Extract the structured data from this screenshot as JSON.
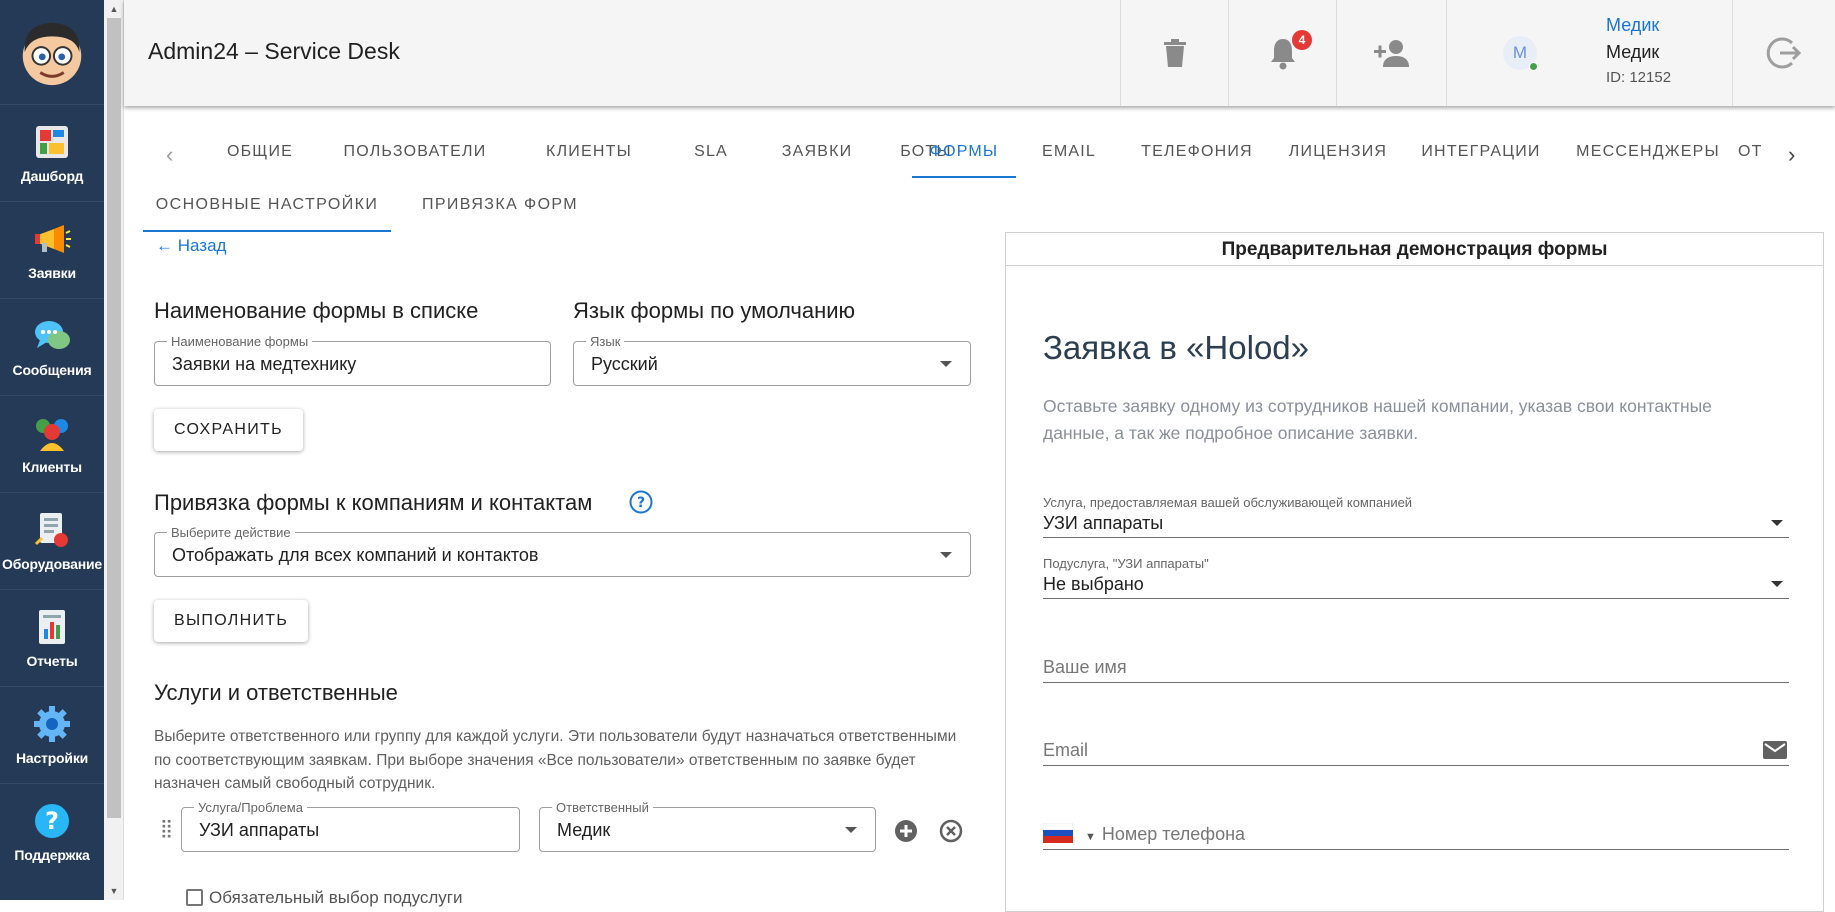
{
  "header": {
    "app_title": "Admin24 – Service Desk",
    "notifications_count": "4",
    "user": {
      "initial": "М",
      "link": "Медик",
      "name": "Медик",
      "id": "ID: 12152"
    }
  },
  "sidebar": {
    "items": [
      {
        "label": "Дашборд",
        "icon": "dashboard-icon"
      },
      {
        "label": "Заявки",
        "icon": "megaphone-icon"
      },
      {
        "label": "Сообщения",
        "icon": "chat-icon"
      },
      {
        "label": "Клиенты",
        "icon": "clients-icon"
      },
      {
        "label": "Оборудование",
        "icon": "equipment-icon"
      },
      {
        "label": "Отчеты",
        "icon": "reports-icon"
      },
      {
        "label": "Настройки",
        "icon": "gear-icon"
      },
      {
        "label": "Поддержка",
        "icon": "help-icon"
      }
    ]
  },
  "tabs": [
    {
      "label": "ОБЩИЕ"
    },
    {
      "label": "ПОЛЬЗОВАТЕЛИ"
    },
    {
      "label": "КЛИЕНТЫ"
    },
    {
      "label": "SLA"
    },
    {
      "label": "ЗАЯВКИ"
    },
    {
      "label": "БОТЫ"
    },
    {
      "label": "ФОРМЫ"
    },
    {
      "label": "EMAIL"
    },
    {
      "label": "ТЕЛЕФОНИЯ"
    },
    {
      "label": "ЛИЦЕНЗИЯ"
    },
    {
      "label": "ИНТЕГРАЦИИ"
    },
    {
      "label": "МЕССЕНДЖЕРЫ"
    },
    {
      "label": "ОТ"
    }
  ],
  "active_tab": "ФОРМЫ",
  "subtabs": [
    {
      "label": "ОСНОВНЫЕ НАСТРОЙКИ"
    },
    {
      "label": "ПРИВЯЗКА ФОРМ"
    }
  ],
  "left": {
    "back_label": "Назад",
    "name_section_title": "Наименование формы в списке",
    "name_field_label": "Наименование формы",
    "name_field_value": "Заявки на медтехнику",
    "lang_section_title": "Язык формы по умолчанию",
    "lang_field_label": "Язык",
    "lang_field_value": "Русский",
    "save_button": "СОХРАНИТЬ",
    "binding_title": "Привязка формы к компаниям и контактам",
    "action_field_label": "Выберите действие",
    "action_field_value": "Отображать для всех компаний и контактов",
    "execute_button": "ВЫПОЛНИТЬ",
    "services_title": "Услуги и ответственные",
    "services_desc": "Выберите ответственного или группу для каждой услуги. Эти пользователи будут назначаться ответственными по соответствующим заявкам. При выборе значения «Все пользователи» ответственным по заявке будет назначен самый свободный сотрудник.",
    "service_field_label": "Услуга/Проблема",
    "service_field_value": "УЗИ аппараты",
    "responsible_field_label": "Ответственный",
    "responsible_field_value": "Медик",
    "checkbox_label": "Обязательный выбор подуслуги"
  },
  "preview": {
    "title": "Предварительная демонстрация формы",
    "heading": "Заявка в «Holod»",
    "subtitle": "Оставьте заявку одному из сотрудников нашей компании, указав свои контактные данные, а так же подробное описание заявки.",
    "service_label": "Услуга, предоставляемая вашей обслуживающей компанией",
    "service_value": "УЗИ аппараты",
    "subservice_label": "Подуслуга, \"УЗИ аппараты\"",
    "subservice_value": "Не выбрано",
    "name_placeholder": "Ваше имя",
    "email_placeholder": "Email",
    "phone_placeholder": "Номер телефона"
  },
  "colors": {
    "sidebar": "#253a57",
    "accent": "#1976d2",
    "badge": "#e53935"
  }
}
